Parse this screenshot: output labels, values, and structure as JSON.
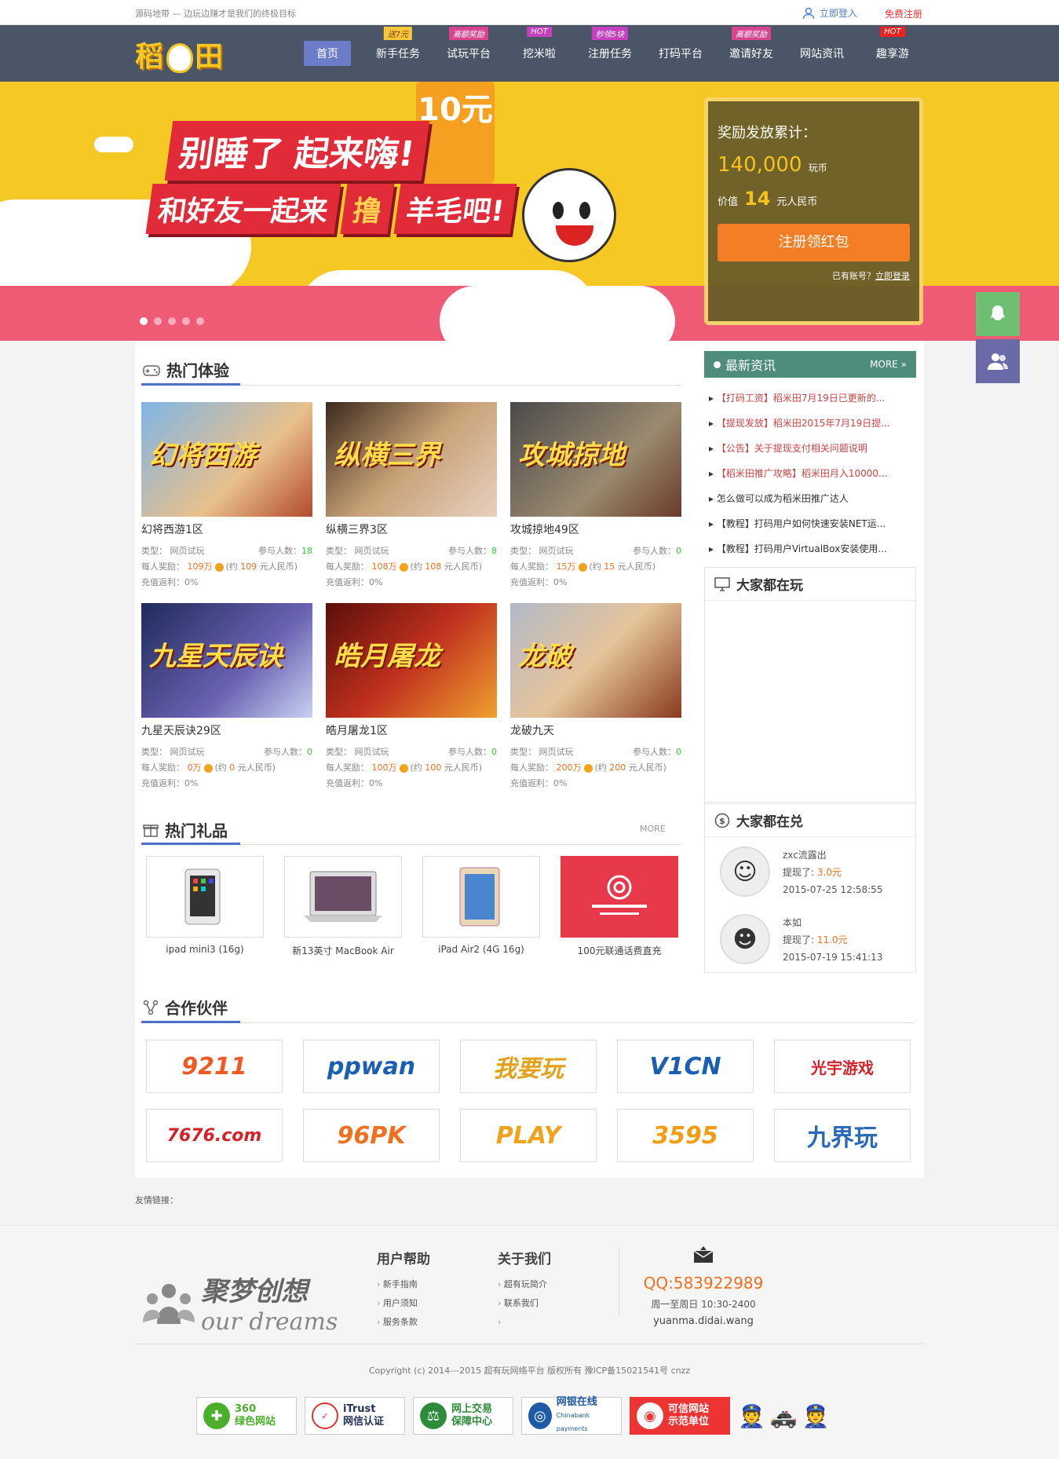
{
  "topbar": {
    "slogan": "源码地带 — 边玩边赚才是我们的终极目标",
    "login": "立即登入",
    "register": "免费注册"
  },
  "logo": {
    "text": "稻田"
  },
  "nav": [
    {
      "label": "首页",
      "badge": ""
    },
    {
      "label": "新手任务",
      "badge": "送7元"
    },
    {
      "label": "试玩平台",
      "badge": "高额奖励"
    },
    {
      "label": "挖米啦",
      "badge": "HOT"
    },
    {
      "label": "注册任务",
      "badge": "秒领5块"
    },
    {
      "label": "打码平台",
      "badge": ""
    },
    {
      "label": "邀请好友",
      "badge": "高额奖励"
    },
    {
      "label": "网站资讯",
      "badge": ""
    },
    {
      "label": "趣享游",
      "badge": "HOT"
    }
  ],
  "hero": {
    "line1": "别睡了 起来嗨!",
    "line2a": "和好友一起来",
    "line2b": "撸",
    "line2c": "羊毛吧!",
    "tag": "10元",
    "reward": {
      "title": "奖励发放累计：",
      "amount": "140,000",
      "amount_unit": "玩币",
      "value_label": "价值",
      "value": "14",
      "value_unit": "元人民币",
      "button": "注册领红包",
      "has_account": "已有账号？",
      "login_link": "立即登录"
    }
  },
  "hot": {
    "title": "热门体验",
    "games": [
      {
        "name": "幻将西游1区",
        "type": "网页试玩",
        "people": "18",
        "reward": "109万",
        "rmb": "109",
        "rebate": "0%",
        "art": "幻将西游"
      },
      {
        "name": "纵横三界3区",
        "type": "网页试玩",
        "people": "8",
        "reward": "108万",
        "rmb": "108",
        "rebate": "0%",
        "art": "纵横三界"
      },
      {
        "name": "攻城掠地49区",
        "type": "网页试玩",
        "people": "0",
        "reward": "15万",
        "rmb": "15",
        "rebate": "0%",
        "art": "攻城掠地"
      },
      {
        "name": "九星天辰诀29区",
        "type": "网页试玩",
        "people": "0",
        "reward": "0万",
        "rmb": "0",
        "rebate": "0%",
        "art": "九星天辰诀"
      },
      {
        "name": "皓月屠龙1区",
        "type": "网页试玩",
        "people": "0",
        "reward": "100万",
        "rmb": "100",
        "rebate": "0%",
        "art": "皓月屠龙"
      },
      {
        "name": "龙破九天",
        "type": "网页试玩",
        "people": "0",
        "reward": "200万",
        "rmb": "200",
        "rebate": "0%",
        "art": "龙破"
      }
    ],
    "labels": {
      "type": "类型：",
      "people": "参与人数：",
      "reward": "每人奖励：",
      "approx": "(约",
      "rmb_unit": "元人民币)",
      "rebate": "充值返利："
    }
  },
  "gifts": {
    "title": "热门礼品",
    "more": "MORE",
    "items": [
      {
        "name": "ipad mini3 (16g)"
      },
      {
        "name": "新13英寸 MacBook Air"
      },
      {
        "name": "iPad Air2 (4G 16g)"
      },
      {
        "name": "100元联通话费直充"
      }
    ]
  },
  "partners": {
    "title": "合作伙伴",
    "items": [
      "9211",
      "ppwan",
      "我要玩",
      "V1CN",
      "光宇游戏",
      "7676.com",
      "96PK",
      "PLAY",
      "3595",
      "九界玩"
    ]
  },
  "news": {
    "title": "最新资讯",
    "more": "MORE",
    "items": [
      {
        "text": "【打码工资】稻米田7月19日已更新的...",
        "red": true
      },
      {
        "text": "【提现发放】稻米田2015年7月19日提...",
        "red": true
      },
      {
        "text": "【公告】关于提现支付相关问题说明",
        "red": true
      },
      {
        "text": "【稻米田推广攻略】稻米田月入10000...",
        "red": true
      },
      {
        "text": "怎么做可以成为稻米田推广达人",
        "red": false
      },
      {
        "text": "【教程】打码用户如何快速安装NET运...",
        "red": false
      },
      {
        "text": "【教程】打码用户VirtualBox安装使用...",
        "red": false
      }
    ]
  },
  "playing": {
    "title": "大家都在玩"
  },
  "exchange": {
    "title": "大家都在兑",
    "users": [
      {
        "name": "zxc流露出",
        "label": "提现了:",
        "amount": "3.0元",
        "time": "2015-07-25 12:58:55"
      },
      {
        "name": "本如",
        "label": "提现了:",
        "amount": "11.0元",
        "time": "2015-07-19 15:41:13"
      }
    ]
  },
  "friends": {
    "label": "友情链接："
  },
  "footer": {
    "logo_cn": "聚梦创想",
    "logo_en": "our dreams",
    "help": {
      "title": "用户帮助",
      "items": [
        "新手指南",
        "用户须知",
        "服务条款"
      ]
    },
    "about": {
      "title": "关于我们",
      "items": [
        "超有玩简介",
        "联系我们",
        ""
      ]
    },
    "qq": "QQ:583922989",
    "hours": "周一至周日 10:30-2400",
    "site": "yuanma.didai.wang",
    "copyright": "Copyright (c) 2014---2015 超有玩网络平台 版权所有 豫ICP备15021541号    cnzz",
    "badges": [
      {
        "t1": "360",
        "t2": "绿色网站",
        "color": "#4caf2c"
      },
      {
        "t1": "iTrust",
        "t2": "网信认证",
        "color": "#d33"
      },
      {
        "t1": "网上交易",
        "t2": "保障中心",
        "color": "#2e8b3c"
      },
      {
        "t1": "网银在线",
        "t2": "Chinabank payments",
        "color": "#1e5aa8"
      },
      {
        "t1": "可信网站",
        "t2": "示范单位",
        "color": "#e33"
      }
    ]
  },
  "colors": {
    "nav": "#4b5568",
    "accent": "#f47b26",
    "hero": "#f6c824",
    "news": "#4e8d7b"
  }
}
